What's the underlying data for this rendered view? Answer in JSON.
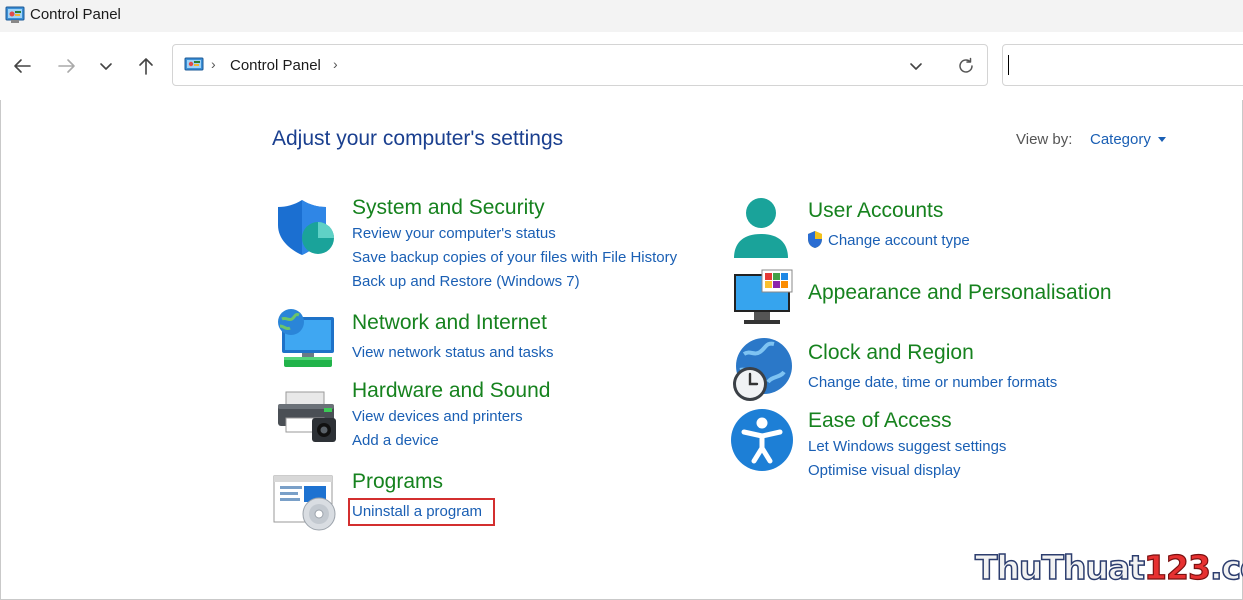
{
  "window": {
    "title": "Control Panel"
  },
  "address_bar": {
    "crumbs": [
      "Control Panel"
    ]
  },
  "search": {
    "value": ""
  },
  "page": {
    "heading": "Adjust your computer's settings",
    "view_by_label": "View by:",
    "view_by_value": "Category"
  },
  "categories": {
    "system_security": {
      "title": "System and Security",
      "links": [
        "Review your computer's status",
        "Save backup copies of your files with File History",
        "Back up and Restore (Windows 7)"
      ]
    },
    "network_internet": {
      "title": "Network and Internet",
      "links": [
        "View network status and tasks"
      ]
    },
    "hardware_sound": {
      "title": "Hardware and Sound",
      "links": [
        "View devices and printers",
        "Add a device"
      ]
    },
    "programs": {
      "title": "Programs",
      "links": [
        "Uninstall a program"
      ]
    },
    "user_accounts": {
      "title": "User Accounts",
      "links": [
        "Change account type"
      ]
    },
    "appearance": {
      "title": "Appearance and Personalisation",
      "links": []
    },
    "clock_region": {
      "title": "Clock and Region",
      "links": [
        "Change date, time or number formats"
      ]
    },
    "ease_access": {
      "title": "Ease of Access",
      "links": [
        "Let Windows suggest settings",
        "Optimise visual display"
      ]
    }
  },
  "highlight": {
    "target": "Uninstall a program",
    "color": "#d32f2f"
  },
  "watermark": {
    "part1": "ThuThuat",
    "part2": "123",
    "part3": ".com"
  },
  "colors": {
    "category_title": "#16821e",
    "link": "#1a5fb4",
    "heading": "#1a3f8f"
  },
  "icons": [
    "back-arrow-icon",
    "forward-arrow-icon",
    "recent-dropdown-icon",
    "up-arrow-icon",
    "refresh-icon",
    "shield-icon",
    "network-icon",
    "printer-icon",
    "programs-icon",
    "user-icon",
    "uac-shield-icon",
    "monitor-icon",
    "clock-globe-icon",
    "accessibility-icon"
  ]
}
